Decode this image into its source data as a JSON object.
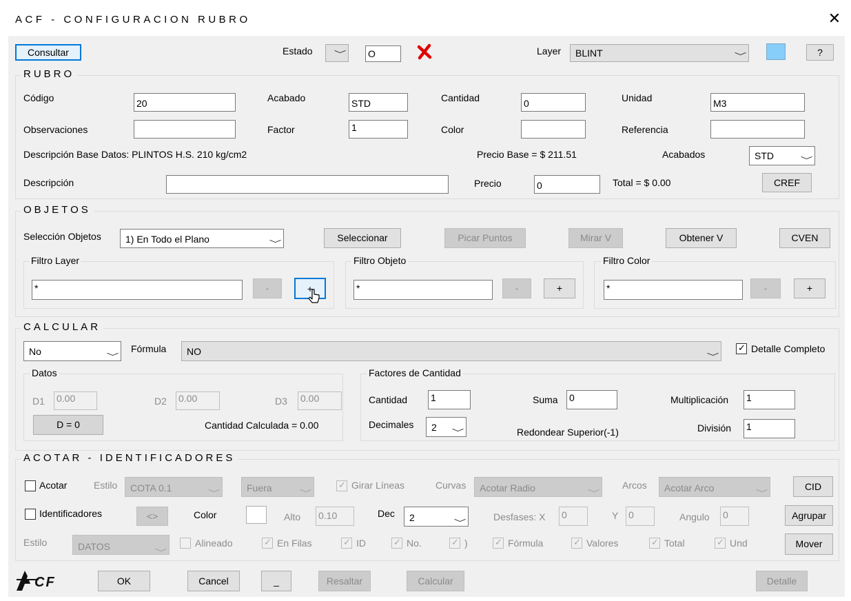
{
  "window": {
    "title": "ACF - CONFIGURACION  RUBRO",
    "close": "✕"
  },
  "top": {
    "consultar": "Consultar",
    "estado_label": "Estado",
    "estado_value": "O",
    "layer_label": "Layer",
    "layer_value": "BLINT",
    "help_label": "?",
    "color_swatch": "#87cefa",
    "error_color": "#e00000"
  },
  "rubro": {
    "title": "RUBRO",
    "codigo_label": "Código",
    "codigo_value": "20",
    "acabado_label": "Acabado",
    "acabado_value": "STD",
    "cantidad_label": "Cantidad",
    "cantidad_value": "0",
    "unidad_label": "Unidad",
    "unidad_value": "M3",
    "observaciones_label": "Observaciones",
    "observaciones_value": "",
    "factor_label": "Factor",
    "factor_value": "1",
    "color_label": "Color",
    "color_value": "",
    "referencia_label": "Referencia",
    "referencia_value": "",
    "desc_base": "Descripción Base Datos: PLINTOS H.S. 210 kg/cm2",
    "precio_base": "Precio Base = $ 211.51",
    "acabados_label": "Acabados",
    "acabados_value": "STD",
    "descripcion_label": "Descripción",
    "descripcion_value": "",
    "precio_label": "Precio",
    "precio_value": "0",
    "total": "Total = $ 0.00",
    "cref": "CREF"
  },
  "objetos": {
    "title": "OBJETOS",
    "seleccion_label": "Selección Objetos",
    "seleccion_value": "1) En Todo el Plano",
    "seleccionar": "Seleccionar",
    "picar_puntos": "Picar Puntos",
    "mirar_v": "Mirar V",
    "obtener_v": "Obtener V",
    "cven": "CVEN",
    "filtro_layer": {
      "title": "Filtro Layer",
      "value": "*",
      "minus": "-",
      "plus": "+"
    },
    "filtro_objeto": {
      "title": "Filtro Objeto",
      "value": "*",
      "minus": "-",
      "plus": "+"
    },
    "filtro_color": {
      "title": "Filtro Color",
      "value": "*",
      "minus": "-",
      "plus": "+"
    }
  },
  "calcular": {
    "title": "CALCULAR",
    "modo_value": "No",
    "formula_label": "Fórmula",
    "formula_value": "NO",
    "detalle_completo": "Detalle Completo",
    "datos": {
      "title": "Datos",
      "d1_label": "D1",
      "d1_value": "0.00",
      "d2_label": "D2",
      "d2_value": "0.00",
      "d3_label": "D3",
      "d3_value": "0.00",
      "d_button": "D = 0",
      "cantidad_calculada": "Cantidad Calculada = 0.00"
    },
    "factores": {
      "title": "Factores de Cantidad",
      "cantidad_label": "Cantidad",
      "cantidad_value": "1",
      "suma_label": "Suma",
      "suma_value": "0",
      "multiplicacion_label": "Multiplicación",
      "multiplicacion_value": "1",
      "decimales_label": "Decimales",
      "decimales_value": "2",
      "redondear": "Redondear Superior(-1)",
      "division_label": "División",
      "division_value": "1"
    }
  },
  "acotar": {
    "title": "ACOTAR - IDENTIFICADORES",
    "acotar_label": "Acotar",
    "estilo_label": "Estilo",
    "estilo_value": "COTA 0.1",
    "fuera_value": "Fuera",
    "girar_lineas": "Girar Líneas",
    "curvas_label": "Curvas",
    "curvas_value": "Acotar Radio",
    "arcos_label": "Arcos",
    "arcos_value": "Acotar Arco",
    "cid": "CID",
    "identificadores_label": "Identificadores",
    "swap_button": "<>",
    "color_label": "Color",
    "alto_label": "Alto",
    "alto_value": "0.10",
    "dec_label": "Dec",
    "dec_value": "2",
    "desfases_label": "Desfases: X",
    "desfases_x": "0",
    "y_label": "Y",
    "y_value": "0",
    "angulo_label": "Angulo",
    "angulo_value": "0",
    "agrupar": "Agrupar",
    "estilo2_label": "Estilo",
    "estilo2_value": "DATOS",
    "alineado": "Alineado",
    "en_filas": "En Filas",
    "id": "ID",
    "no": "No.",
    "paren": ")",
    "formula": "Fórmula",
    "valores": "Valores",
    "total": "Total",
    "und": "Und",
    "mover": "Mover"
  },
  "bottom": {
    "logo_text": "CF",
    "ok": "OK",
    "cancel": "Cancel",
    "underscore": "_",
    "resaltar": "Resaltar",
    "calcular": "Calcular",
    "detalle": "Detalle"
  }
}
